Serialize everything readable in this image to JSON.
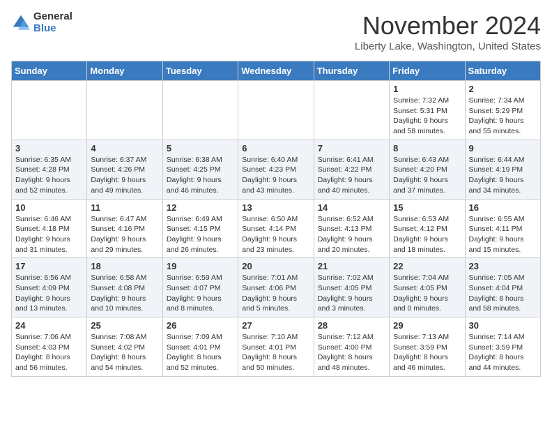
{
  "header": {
    "logo_general": "General",
    "logo_blue": "Blue",
    "month_title": "November 2024",
    "location": "Liberty Lake, Washington, United States"
  },
  "weekdays": [
    "Sunday",
    "Monday",
    "Tuesday",
    "Wednesday",
    "Thursday",
    "Friday",
    "Saturday"
  ],
  "weeks": [
    [
      {
        "day": "",
        "info": ""
      },
      {
        "day": "",
        "info": ""
      },
      {
        "day": "",
        "info": ""
      },
      {
        "day": "",
        "info": ""
      },
      {
        "day": "",
        "info": ""
      },
      {
        "day": "1",
        "info": "Sunrise: 7:32 AM\nSunset: 5:31 PM\nDaylight: 9 hours\nand 58 minutes."
      },
      {
        "day": "2",
        "info": "Sunrise: 7:34 AM\nSunset: 5:29 PM\nDaylight: 9 hours\nand 55 minutes."
      }
    ],
    [
      {
        "day": "3",
        "info": "Sunrise: 6:35 AM\nSunset: 4:28 PM\nDaylight: 9 hours\nand 52 minutes."
      },
      {
        "day": "4",
        "info": "Sunrise: 6:37 AM\nSunset: 4:26 PM\nDaylight: 9 hours\nand 49 minutes."
      },
      {
        "day": "5",
        "info": "Sunrise: 6:38 AM\nSunset: 4:25 PM\nDaylight: 9 hours\nand 46 minutes."
      },
      {
        "day": "6",
        "info": "Sunrise: 6:40 AM\nSunset: 4:23 PM\nDaylight: 9 hours\nand 43 minutes."
      },
      {
        "day": "7",
        "info": "Sunrise: 6:41 AM\nSunset: 4:22 PM\nDaylight: 9 hours\nand 40 minutes."
      },
      {
        "day": "8",
        "info": "Sunrise: 6:43 AM\nSunset: 4:20 PM\nDaylight: 9 hours\nand 37 minutes."
      },
      {
        "day": "9",
        "info": "Sunrise: 6:44 AM\nSunset: 4:19 PM\nDaylight: 9 hours\nand 34 minutes."
      }
    ],
    [
      {
        "day": "10",
        "info": "Sunrise: 6:46 AM\nSunset: 4:18 PM\nDaylight: 9 hours\nand 31 minutes."
      },
      {
        "day": "11",
        "info": "Sunrise: 6:47 AM\nSunset: 4:16 PM\nDaylight: 9 hours\nand 29 minutes."
      },
      {
        "day": "12",
        "info": "Sunrise: 6:49 AM\nSunset: 4:15 PM\nDaylight: 9 hours\nand 26 minutes."
      },
      {
        "day": "13",
        "info": "Sunrise: 6:50 AM\nSunset: 4:14 PM\nDaylight: 9 hours\nand 23 minutes."
      },
      {
        "day": "14",
        "info": "Sunrise: 6:52 AM\nSunset: 4:13 PM\nDaylight: 9 hours\nand 20 minutes."
      },
      {
        "day": "15",
        "info": "Sunrise: 6:53 AM\nSunset: 4:12 PM\nDaylight: 9 hours\nand 18 minutes."
      },
      {
        "day": "16",
        "info": "Sunrise: 6:55 AM\nSunset: 4:11 PM\nDaylight: 9 hours\nand 15 minutes."
      }
    ],
    [
      {
        "day": "17",
        "info": "Sunrise: 6:56 AM\nSunset: 4:09 PM\nDaylight: 9 hours\nand 13 minutes."
      },
      {
        "day": "18",
        "info": "Sunrise: 6:58 AM\nSunset: 4:08 PM\nDaylight: 9 hours\nand 10 minutes."
      },
      {
        "day": "19",
        "info": "Sunrise: 6:59 AM\nSunset: 4:07 PM\nDaylight: 9 hours\nand 8 minutes."
      },
      {
        "day": "20",
        "info": "Sunrise: 7:01 AM\nSunset: 4:06 PM\nDaylight: 9 hours\nand 5 minutes."
      },
      {
        "day": "21",
        "info": "Sunrise: 7:02 AM\nSunset: 4:05 PM\nDaylight: 9 hours\nand 3 minutes."
      },
      {
        "day": "22",
        "info": "Sunrise: 7:04 AM\nSunset: 4:05 PM\nDaylight: 9 hours\nand 0 minutes."
      },
      {
        "day": "23",
        "info": "Sunrise: 7:05 AM\nSunset: 4:04 PM\nDaylight: 8 hours\nand 58 minutes."
      }
    ],
    [
      {
        "day": "24",
        "info": "Sunrise: 7:06 AM\nSunset: 4:03 PM\nDaylight: 8 hours\nand 56 minutes."
      },
      {
        "day": "25",
        "info": "Sunrise: 7:08 AM\nSunset: 4:02 PM\nDaylight: 8 hours\nand 54 minutes."
      },
      {
        "day": "26",
        "info": "Sunrise: 7:09 AM\nSunset: 4:01 PM\nDaylight: 8 hours\nand 52 minutes."
      },
      {
        "day": "27",
        "info": "Sunrise: 7:10 AM\nSunset: 4:01 PM\nDaylight: 8 hours\nand 50 minutes."
      },
      {
        "day": "28",
        "info": "Sunrise: 7:12 AM\nSunset: 4:00 PM\nDaylight: 8 hours\nand 48 minutes."
      },
      {
        "day": "29",
        "info": "Sunrise: 7:13 AM\nSunset: 3:59 PM\nDaylight: 8 hours\nand 46 minutes."
      },
      {
        "day": "30",
        "info": "Sunrise: 7:14 AM\nSunset: 3:59 PM\nDaylight: 8 hours\nand 44 minutes."
      }
    ]
  ]
}
